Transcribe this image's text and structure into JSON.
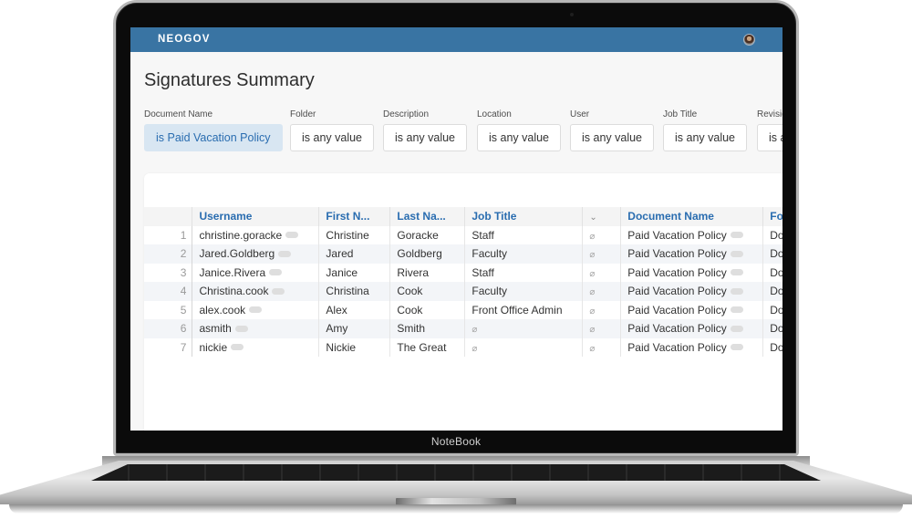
{
  "device": {
    "brand_label": "NoteBook"
  },
  "app": {
    "logo": "NEOGOV",
    "avatar_alt": "user-avatar"
  },
  "page": {
    "title": "Signatures Summary"
  },
  "filters": [
    {
      "label": "Document Name",
      "value": "is Paid Vacation Policy",
      "active": true
    },
    {
      "label": "Folder",
      "value": "is any value",
      "active": false
    },
    {
      "label": "Description",
      "value": "is any value",
      "active": false
    },
    {
      "label": "Location",
      "value": "is any value",
      "active": false
    },
    {
      "label": "User",
      "value": "is any value",
      "active": false
    },
    {
      "label": "Job Title",
      "value": "is any value",
      "active": false
    },
    {
      "label": "Revision",
      "value": "is any value",
      "active": false
    }
  ],
  "table": {
    "columns": [
      "",
      "Username",
      "First N...",
      "Last Na...",
      "Job Title",
      "⌄",
      "Document Name",
      "Folder"
    ],
    "null_symbol": "⌀",
    "rows": [
      {
        "idx": "1",
        "username": "christine.goracke",
        "first": "Christine",
        "last": "Goracke",
        "job": "Staff",
        "doc": "Paid Vacation Policy",
        "folder": "Doc"
      },
      {
        "idx": "2",
        "username": "Jared.Goldberg",
        "first": "Jared",
        "last": "Goldberg",
        "job": "Faculty",
        "doc": "Paid Vacation Policy",
        "folder": "Doc"
      },
      {
        "idx": "3",
        "username": "Janice.Rivera",
        "first": "Janice",
        "last": "Rivera",
        "job": "Staff",
        "doc": "Paid Vacation Policy",
        "folder": "Doc"
      },
      {
        "idx": "4",
        "username": "Christina.cook",
        "first": "Christina",
        "last": "Cook",
        "job": "Faculty",
        "doc": "Paid Vacation Policy",
        "folder": "Doc"
      },
      {
        "idx": "5",
        "username": "alex.cook",
        "first": "Alex",
        "last": "Cook",
        "job": "Front Office Admin",
        "doc": "Paid Vacation Policy",
        "folder": "Doc"
      },
      {
        "idx": "6",
        "username": "asmith",
        "first": "Amy",
        "last": "Smith",
        "job": null,
        "doc": "Paid Vacation Policy",
        "folder": "Doc"
      },
      {
        "idx": "7",
        "username": "nickie",
        "first": "Nickie",
        "last": "The Great",
        "job": null,
        "doc": "Paid Vacation Policy",
        "folder": "Doc"
      }
    ]
  }
}
